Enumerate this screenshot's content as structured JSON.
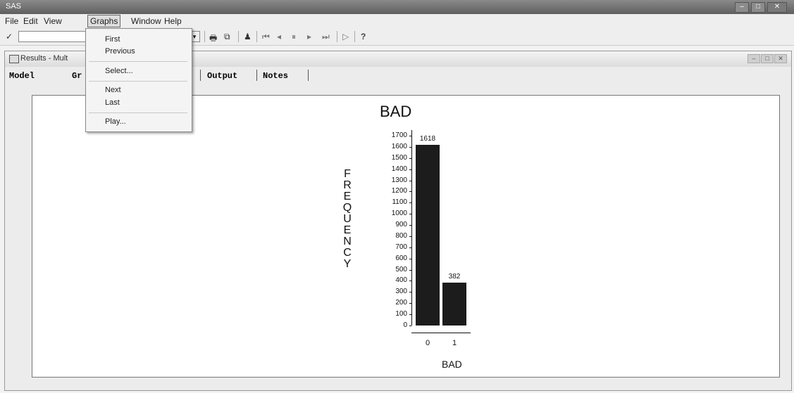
{
  "app": {
    "title": "SAS"
  },
  "menubar": {
    "items": [
      "File",
      "Edit",
      "View",
      "Graphs",
      "Window",
      "Help"
    ],
    "active": "Graphs"
  },
  "toolbar": {
    "check": "✓",
    "help": "?"
  },
  "graphs_menu": {
    "items": [
      "First",
      "Previous",
      "Select...",
      "Next",
      "Last",
      "Play..."
    ]
  },
  "results_window": {
    "title": "Results - Mult",
    "tabs": [
      "Model",
      "Gr",
      "Output",
      "Notes"
    ]
  },
  "chart_data": {
    "type": "bar",
    "title": "BAD",
    "xlabel": "BAD",
    "ylabel": "FREQUENCY",
    "categories": [
      "0",
      "1"
    ],
    "values": [
      1618,
      382
    ],
    "data_labels": [
      "1618",
      "382"
    ],
    "yticks": [
      0,
      100,
      200,
      300,
      400,
      500,
      600,
      700,
      800,
      900,
      1000,
      1100,
      1200,
      1300,
      1400,
      1500,
      1600,
      1700
    ],
    "ylim": [
      0,
      1700
    ],
    "bar_color": "#1c1c1c"
  }
}
